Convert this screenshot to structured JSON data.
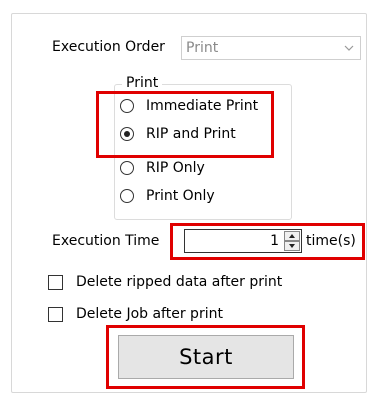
{
  "execution_order": {
    "label": "Execution Order",
    "value": "Print"
  },
  "print_group": {
    "title": "Print",
    "options": [
      {
        "label": "Immediate Print",
        "checked": false
      },
      {
        "label": "RIP and Print",
        "checked": true
      },
      {
        "label": "RIP Only",
        "checked": false
      },
      {
        "label": "Print Only",
        "checked": false
      }
    ]
  },
  "execution_time": {
    "label": "Execution Time",
    "value": "1",
    "unit": "time(s)"
  },
  "checkboxes": [
    {
      "label": "Delete ripped data after print",
      "checked": false
    },
    {
      "label": "Delete Job after print",
      "checked": false
    }
  ],
  "start_label": "Start",
  "icons": [
    "chevron-down-icon",
    "spin-up-icon",
    "spin-down-icon"
  ],
  "highlight_color": "#e00000"
}
